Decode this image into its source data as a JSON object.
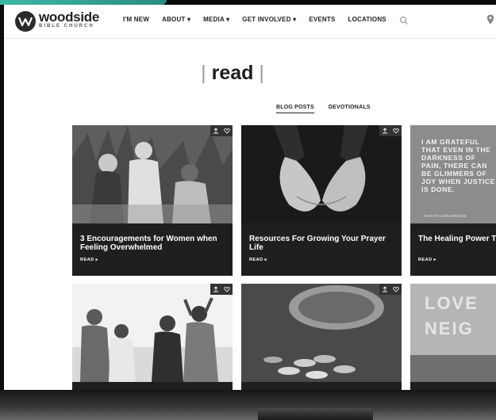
{
  "site": {
    "brand": "woodside",
    "brand_sub": "BIBLE CHURCH"
  },
  "nav": [
    {
      "label": "I'M NEW"
    },
    {
      "label": "ABOUT ▾"
    },
    {
      "label": "MEDIA ▾"
    },
    {
      "label": "GET INVOLVED ▾"
    },
    {
      "label": "EVENTS"
    },
    {
      "label": "LOCATIONS"
    }
  ],
  "icons": {
    "search": "search-icon",
    "location": "location-pin-icon",
    "share": "share-icon",
    "favorite": "heart-icon"
  },
  "page": {
    "title": "read",
    "title_divider": "|"
  },
  "tabs": [
    {
      "label": "BLOG POSTS",
      "active": true
    },
    {
      "label": "DEVOTIONALS",
      "active": false
    }
  ],
  "posts": [
    {
      "title": "3 Encouragements for Women when Feeling Overwhelmed",
      "cta": "READ ▸"
    },
    {
      "title": "Resources For Growing Your Prayer Life",
      "cta": "READ ▸"
    },
    {
      "title": "The Healing Power The Longing for Et",
      "cta": "READ ▸"
    }
  ],
  "quote_card": {
    "text": "I AM GRATEFUL THAT EVEN IN THE DARKNESS OF PAIN, THERE CAN BE GLIMMERS OF JOY WHEN JUSTICE IS DONE.",
    "author": "- PASTOR CHRIS BROOKS"
  },
  "sign_text": [
    "LOVE",
    "NEIG"
  ],
  "colors": {
    "card_bg": "#1f1f1f",
    "accent_teal": "#3fb7a6"
  }
}
